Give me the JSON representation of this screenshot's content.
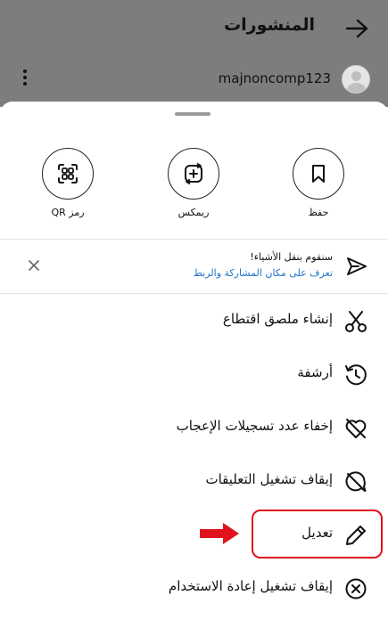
{
  "header": {
    "title": "المنشورات"
  },
  "post": {
    "username": "majnoncomp123"
  },
  "quick_actions": [
    {
      "label": "حفظ",
      "icon": "bookmark-icon"
    },
    {
      "label": "ريمكس",
      "icon": "remix-icon"
    },
    {
      "label": "رمز QR",
      "icon": "qr-code-icon"
    }
  ],
  "banner": {
    "title": "سنقوم بنقل الأشياء!",
    "link": "تعرف على مكان المشاركة والربط",
    "icon": "send-icon"
  },
  "menu": [
    {
      "label": "إنشاء ملصق اقتطاع",
      "icon": "scissors-icon"
    },
    {
      "label": "أرشفة",
      "icon": "archive-history-icon"
    },
    {
      "label": "إخفاء عدد تسجيلات الإعجاب",
      "icon": "heart-off-icon"
    },
    {
      "label": "إيقاف تشغيل التعليقات",
      "icon": "comment-off-icon"
    },
    {
      "label": "تعديل",
      "icon": "pencil-icon"
    },
    {
      "label": "إيقاف تشغيل إعادة الاستخدام",
      "icon": "x-circle-icon"
    }
  ],
  "colors": {
    "highlight": "#e0131c",
    "link": "#1f73c7",
    "overlay": "#7d7d7d"
  }
}
